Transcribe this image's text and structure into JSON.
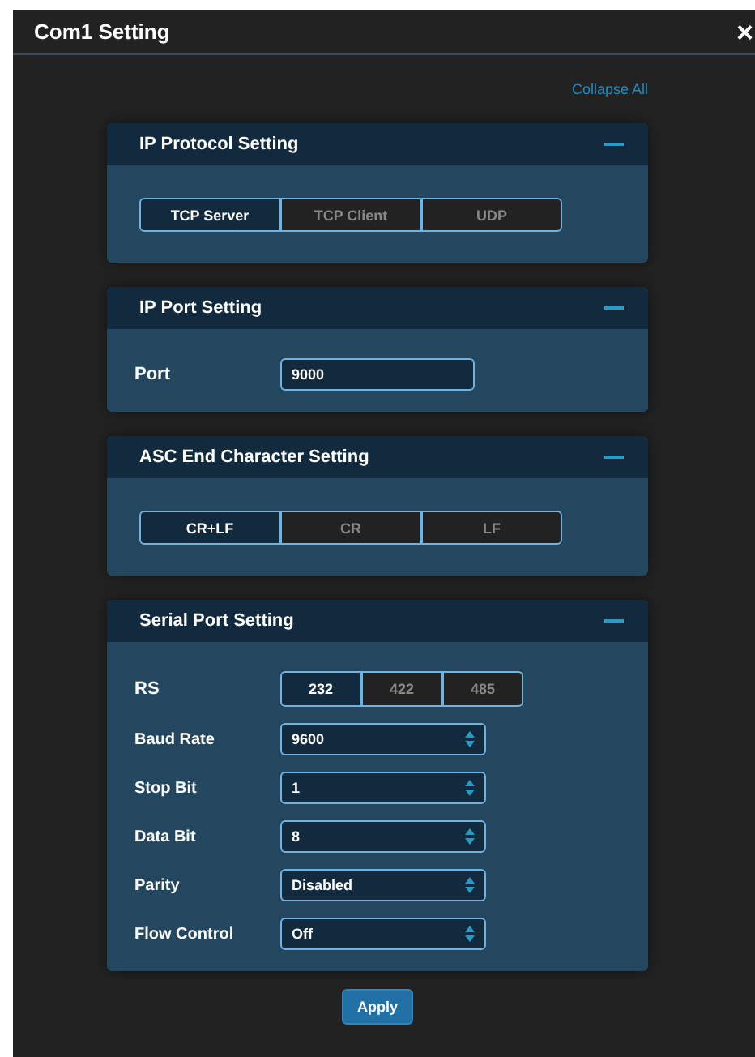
{
  "window": {
    "title": "Com1 Setting",
    "close": "×"
  },
  "collapse_all": "Collapse All",
  "sections": [
    {
      "title": "IP Protocol Setting",
      "expanded": true,
      "rows": [
        {
          "kind": "segmented",
          "options": [
            {
              "label": "TCP Server",
              "selected": true
            },
            {
              "label": "TCP Client",
              "selected": false
            },
            {
              "label": "UDP",
              "selected": false
            }
          ]
        }
      ]
    },
    {
      "title": "IP Port Setting",
      "expanded": true,
      "rows": [
        {
          "kind": "input",
          "label": "Port",
          "value": "9000"
        }
      ]
    },
    {
      "title": "ASC End Character Setting",
      "expanded": true,
      "rows": [
        {
          "kind": "segmented",
          "options": [
            {
              "label": "CR+LF",
              "selected": true
            },
            {
              "label": "CR",
              "selected": false
            },
            {
              "label": "LF",
              "selected": false
            }
          ]
        }
      ]
    },
    {
      "title": "Serial Port Setting",
      "expanded": true,
      "rows": [
        {
          "kind": "segmented",
          "label": "RS",
          "options": [
            {
              "label": "232",
              "selected": true
            },
            {
              "label": "422",
              "selected": false
            },
            {
              "label": "485",
              "selected": false
            }
          ]
        },
        {
          "kind": "select",
          "label": "Baud Rate",
          "value": "9600"
        },
        {
          "kind": "select",
          "label": "Stop Bit",
          "value": "1"
        },
        {
          "kind": "select",
          "label": "Data Bit",
          "value": "8"
        },
        {
          "kind": "select",
          "label": "Parity",
          "value": "Disabled"
        },
        {
          "kind": "select",
          "label": "Flow Control",
          "value": "Off"
        }
      ]
    }
  ],
  "buttons": [
    "Apply"
  ]
}
